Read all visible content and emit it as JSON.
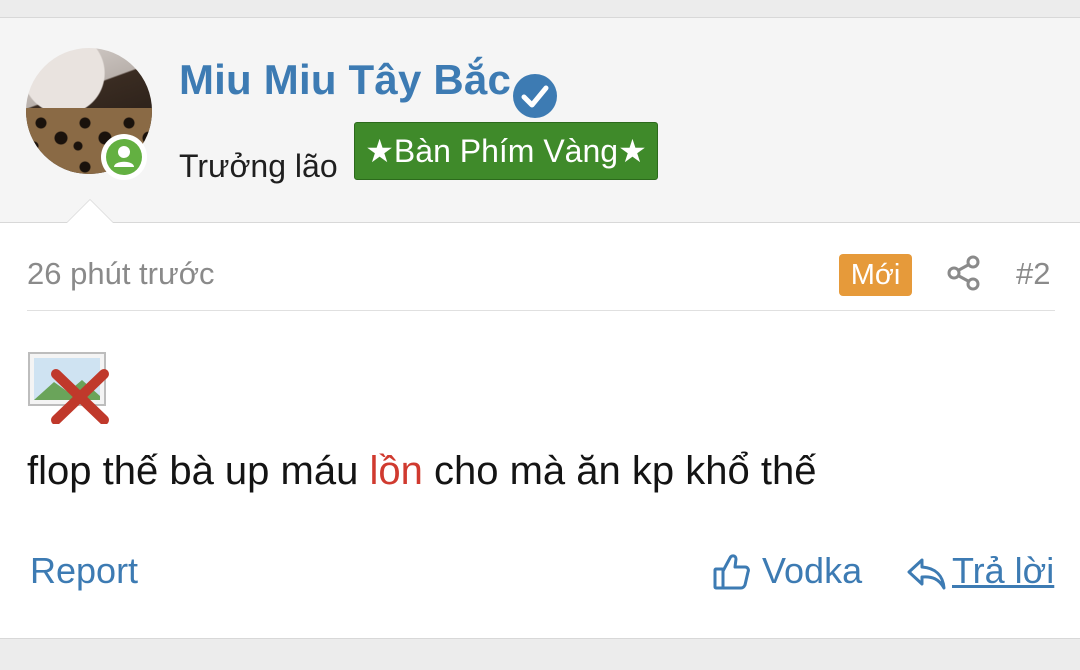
{
  "user": {
    "name": "Miu Miu Tây Bắc",
    "title": "Trưởng lão",
    "banner": "★Bàn Phím Vàng★",
    "verified_icon": "verified-check-icon",
    "online_icon": "online-status-icon"
  },
  "post": {
    "time": "26 phút trước",
    "new_badge": "Mới",
    "number": "#2",
    "message_before": "flop thế bà up máu ",
    "message_highlight": "lồn",
    "message_after": " cho mà ăn kp khổ thế",
    "image_icon": "broken-image-icon"
  },
  "actions": {
    "report": "Report",
    "like": "Vodka",
    "reply": "Trả lời"
  },
  "colors": {
    "link": "#3d7bb3",
    "banner": "#3f8a2a",
    "new_badge": "#e69a3a",
    "highlight": "#d03a2f",
    "online": "#63b041"
  }
}
